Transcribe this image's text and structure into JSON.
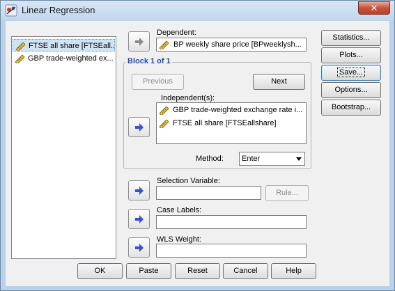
{
  "window": {
    "title": "Linear Regression",
    "close_glyph": "✕"
  },
  "source_variables": [
    {
      "label": "FTSE all share [FTSEall...",
      "icon": "scale-ruler-icon",
      "selected": true
    },
    {
      "label": "GBP trade-weighted ex...",
      "icon": "scale-ruler-icon",
      "selected": false
    }
  ],
  "dependent": {
    "label": "Dependent:",
    "value": "BP weekly share price [BPweeklysh..."
  },
  "block": {
    "title": "Block 1 of 1",
    "previous_label": "Previous",
    "next_label": "Next",
    "independents_label": "Independent(s):",
    "independents": [
      "GBP trade-weighted exchange rate i...",
      "FTSE all share [FTSEallshare]"
    ],
    "method_label": "Method:",
    "method_value": "Enter"
  },
  "selection_variable": {
    "label": "Selection Variable:",
    "value": "",
    "rule_label": "Rule..."
  },
  "case_labels": {
    "label": "Case Labels:",
    "value": ""
  },
  "wls_weight": {
    "label": "WLS Weight:",
    "value": ""
  },
  "side_buttons": {
    "statistics": "Statistics...",
    "plots": "Plots...",
    "save": "Save...",
    "options": "Options...",
    "bootstrap": "Bootstrap..."
  },
  "footer_buttons": {
    "ok": "OK",
    "paste": "Paste",
    "reset": "Reset",
    "cancel": "Cancel",
    "help": "Help"
  },
  "colors": {
    "group_title": "#1f4eb4",
    "arrow_blue": "#3a4ed8",
    "selection": "#cfe3f7"
  }
}
